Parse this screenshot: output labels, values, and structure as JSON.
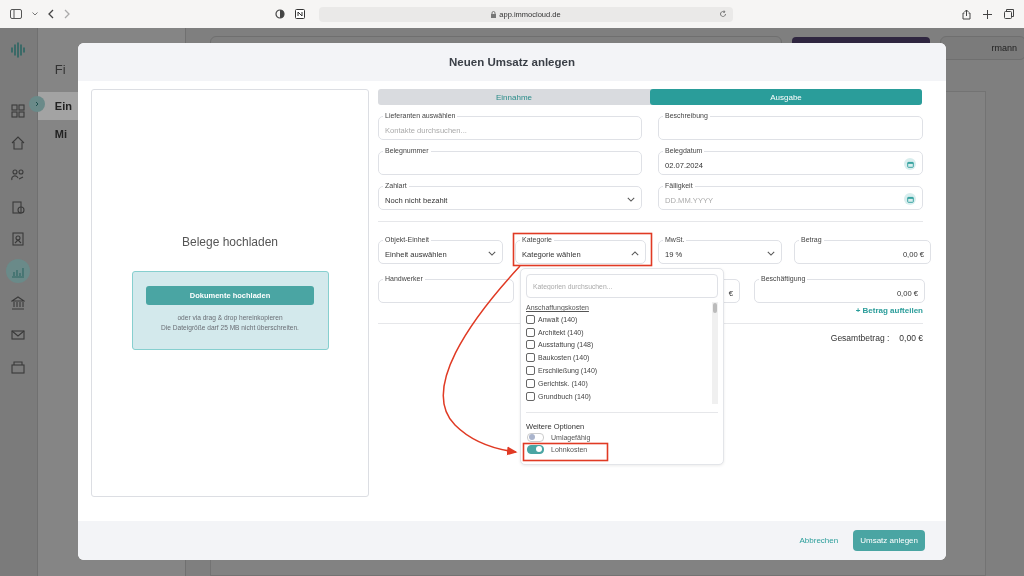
{
  "browser": {
    "url": "app.immocloud.de"
  },
  "sidebar": {
    "items": [
      {
        "selected": false
      },
      {
        "selected": false
      },
      {
        "selected": false
      },
      {
        "selected": false
      },
      {
        "selected": false
      },
      {
        "selected": true
      },
      {
        "selected": false
      },
      {
        "selected": false
      },
      {
        "selected": false
      }
    ]
  },
  "page": {
    "title": "Fi",
    "nav": [
      {
        "label": "Ein",
        "selected": true
      },
      {
        "label": "Mi",
        "selected": false
      }
    ],
    "user_button": "rmann"
  },
  "modal": {
    "title": "Neuen Umsatz anlegen",
    "upload": {
      "heading": "Belege hochladen",
      "button": "Dokumente hochladen",
      "hint": "oder via drag & drop hereinkopieren",
      "limit": "Die Dateigröße darf 25 MB nicht überschreiten."
    },
    "type_tabs": [
      {
        "label": "Einnahme",
        "selected": false
      },
      {
        "label": "Ausgabe",
        "selected": true
      }
    ],
    "upper_rows": [
      [
        {
          "kind": "text",
          "label": "Lieferanten auswählen",
          "placeholder": "Kontakte durchsuchen..."
        },
        {
          "kind": "text",
          "label": "Beschreibung"
        }
      ],
      [
        {
          "kind": "text",
          "label": "Belegnummer"
        },
        {
          "kind": "date",
          "label": "Belegdatum",
          "value": "02.07.2024"
        }
      ],
      [
        {
          "kind": "select",
          "label": "Zahlart",
          "value": "Noch nicht bezahlt",
          "expanded": false
        },
        {
          "kind": "date",
          "label": "Fälligkeit",
          "placeholder": "DD.MM.YYYY"
        }
      ]
    ],
    "booking_row": [
      {
        "kind": "select",
        "label": "Objekt-Einheit",
        "value": "Einheit auswählen",
        "expanded": false
      },
      {
        "kind": "select",
        "label": "Kategorie",
        "value": "Kategorie wählen",
        "expanded": true
      },
      {
        "kind": "select",
        "label": "MwSt.",
        "value": "19 %",
        "expanded": false
      },
      {
        "kind": "amount",
        "label": "Betrag",
        "value": "0,00 €"
      }
    ],
    "staff_row": [
      {
        "kind": "text",
        "label": "Handwerker"
      },
      {
        "kind": "amount",
        "value": "€"
      },
      {
        "kind": "amount",
        "label": "Beschäftigung",
        "value": "0,00 €"
      }
    ],
    "split_link": "+ Betrag aufteilen",
    "total": {
      "label": "Gesamtbetrag :",
      "value": "0,00 €"
    },
    "category_dropdown": {
      "placeholder": "Kategorien durchsuchen...",
      "group": "Anschaffungskosten",
      "options": [
        {
          "label": "Anwalt (140)",
          "checked": false
        },
        {
          "label": "Architekt (140)",
          "checked": false
        },
        {
          "label": "Ausstattung (148)",
          "checked": false
        },
        {
          "label": "Baukosten (140)",
          "checked": false
        },
        {
          "label": "Erschließung (140)",
          "checked": false
        },
        {
          "label": "Gerichtsk. (140)",
          "checked": false
        },
        {
          "label": "Grundbuch (140)",
          "checked": false
        }
      ],
      "options_heading": "Weitere Optionen",
      "toggles": [
        {
          "label": "Umlagefähig",
          "on": false
        },
        {
          "label": "Lohnkosten",
          "on": true
        }
      ]
    },
    "footer": {
      "cancel": "Abbrechen",
      "submit": "Umsatz anlegen"
    }
  }
}
